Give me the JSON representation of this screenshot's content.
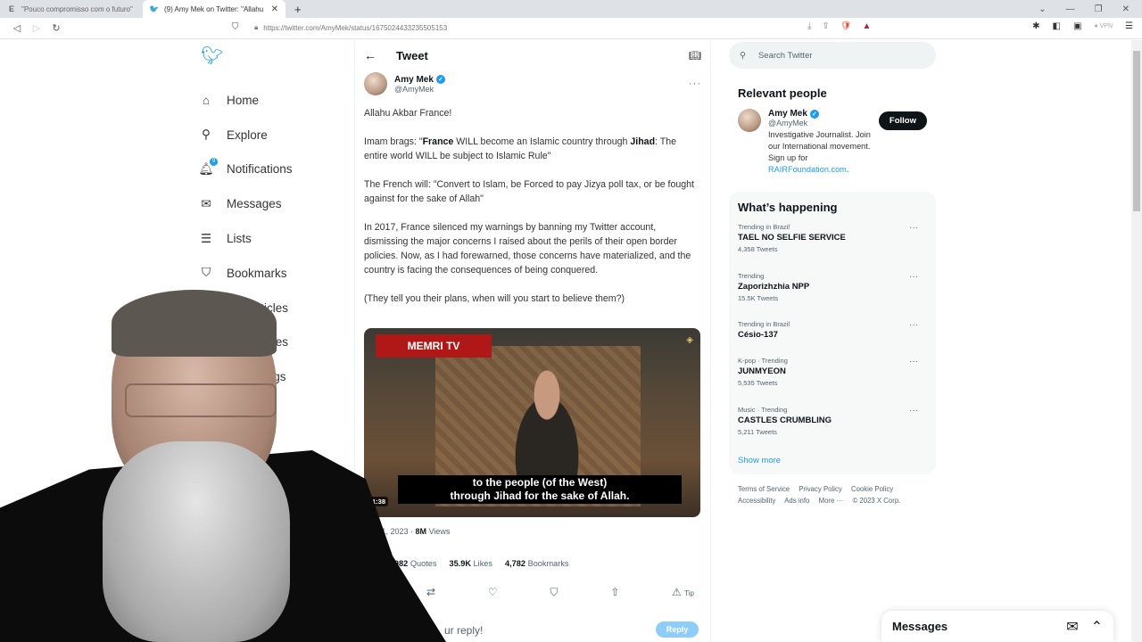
{
  "browser": {
    "tabs": [
      {
        "title": "\"Pouco compromisso com o futuro\"",
        "icon": "E",
        "active": false
      },
      {
        "title": "(9) Amy Mek on Twitter: \"Allahu",
        "icon": "twitter",
        "active": true
      }
    ],
    "url": "https://twitter.com/AmyMek/status/1675024433235505153",
    "vpn_label": "VPN"
  },
  "leftnav": {
    "items": [
      {
        "label": "Home",
        "icon": "home-icon"
      },
      {
        "label": "Explore",
        "icon": "search-icon"
      },
      {
        "label": "Notifications",
        "icon": "bell-icon",
        "badge": "9"
      },
      {
        "label": "Messages",
        "icon": "envelope-icon"
      },
      {
        "label": "Lists",
        "icon": "list-icon"
      },
      {
        "label": "Bookmarks",
        "icon": "bookmark-icon"
      },
      {
        "label": "Top Articles",
        "icon": "article-icon"
      },
      {
        "label": "unities",
        "icon": "communities-icon"
      },
      {
        "label": "d Orgs",
        "icon": "verified-orgs-icon"
      }
    ]
  },
  "tweet": {
    "header_title": "Tweet",
    "author_name": "Amy Mek",
    "author_handle": "@AmyMek",
    "paragraphs": {
      "p1": "Allahu Akbar France!",
      "p2a": "Imam brags: \"",
      "p2b": "France",
      "p2c": " WILL become an Islamic country through ",
      "p2d": "Jihad",
      "p2e": ": The entire world WILL be subject to Islamic Rule\"",
      "p3": "The French will: \"Convert to Islam, be Forced to pay Jizya poll tax, or be fought against for the sake of Allah\"",
      "p4": "In 2017, France silenced my warnings by banning my Twitter account, dismissing the major concerns I raised about the perils of their open border policies. Now, as I had forewarned, those concerns have materialized, and the country is facing the consequences of being conquered.",
      "p5": "(They tell you their plans, when will you start to believe them?)"
    },
    "video": {
      "channel_logo": "MEMRI TV",
      "subtitle_line1": "to the people (of the West)",
      "subtitle_line2": "through Jihad for the sake of Allah.",
      "duration": "1:38"
    },
    "date": "· Jul 1, 2023 ·",
    "views_count": "8M",
    "views_label": "Views",
    "stats": [
      {
        "value": "",
        "label": "ets"
      },
      {
        "value": "1,982",
        "label": "Quotes"
      },
      {
        "value": "35.9K",
        "label": "Likes"
      },
      {
        "value": "4,782",
        "label": "Bookmarks"
      }
    ],
    "tip_label": "Tip",
    "reply_placeholder": "ur reply!",
    "reply_button": "Reply"
  },
  "sidebar": {
    "search_placeholder": "Search Twitter",
    "relevant_title": "Relevant people",
    "person": {
      "name": "Amy Mek",
      "handle": "@AmyMek",
      "bio": "Investigative Journalist. Join our International movement. Sign up for ",
      "bio_link": "RAIRFoundation.com",
      "bio_end": ".",
      "follow_label": "Follow"
    },
    "happening_title": "What’s happening",
    "trends": [
      {
        "category": "Trending in Brazil",
        "name": "TAEL NO SELFIE SERVICE",
        "count": "4,358 Tweets"
      },
      {
        "category": "Trending",
        "name": "Zaporizhzhia NPP",
        "count": "15.5K Tweets"
      },
      {
        "category": "Trending in Brazil",
        "name": "Césio-137",
        "count": ""
      },
      {
        "category": "K-pop · Trending",
        "name": "JUNMYEON",
        "count": "5,535 Tweets"
      },
      {
        "category": "Music · Trending",
        "name": "CASTLES CRUMBLING",
        "count": "5,211 Tweets"
      }
    ],
    "show_more": "Show more",
    "footer": [
      "Terms of Service",
      "Privacy Policy",
      "Cookie Policy",
      "Accessibility",
      "Ads info",
      "More ···",
      "© 2023 X Corp."
    ]
  },
  "messages_dock": {
    "title": "Messages"
  }
}
